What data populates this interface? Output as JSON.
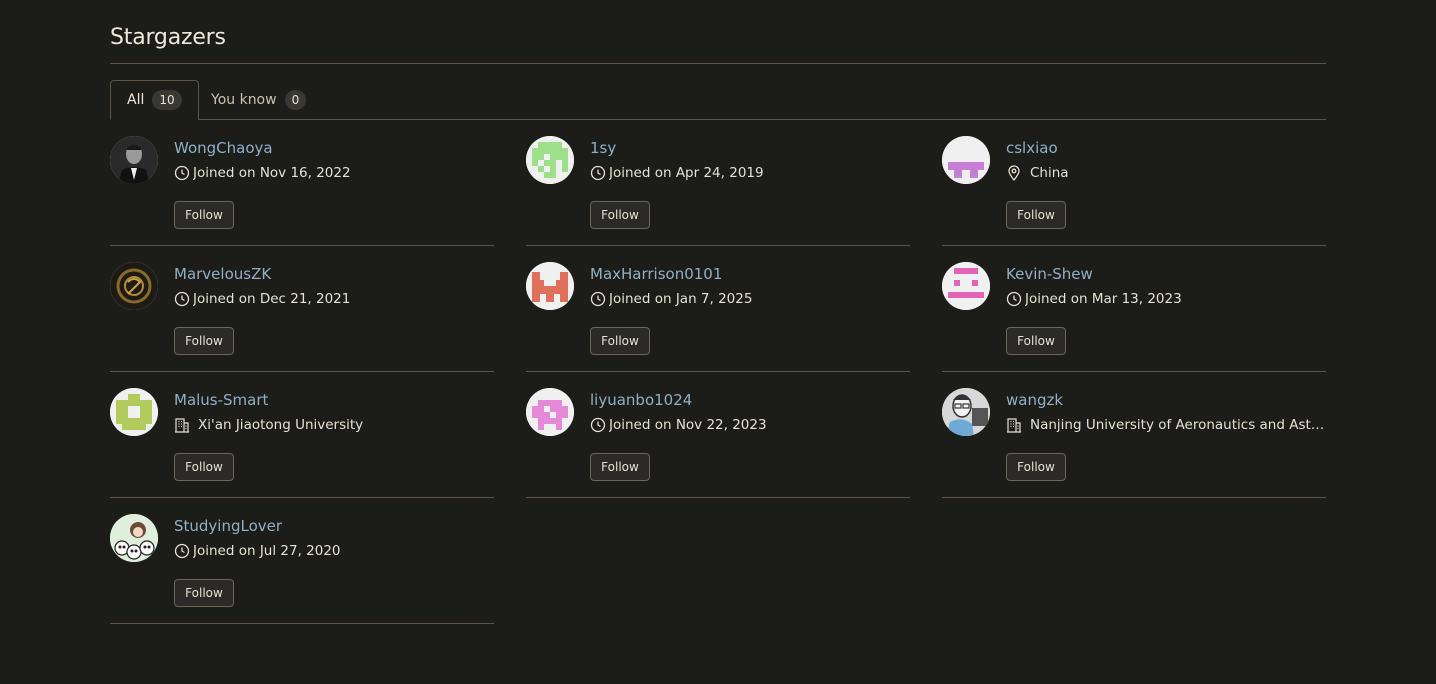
{
  "page": {
    "title": "Stargazers"
  },
  "tabs": [
    {
      "label": "All",
      "count": "10"
    },
    {
      "label": "You know",
      "count": "0"
    }
  ],
  "users": [
    {
      "name": "WongChaoya",
      "meta": "Joined on Nov 16, 2022",
      "meta_icon": "clock-icon",
      "follow": "Follow"
    },
    {
      "name": "1sy",
      "meta": "Joined on Apr 24, 2019",
      "meta_icon": "clock-icon",
      "follow": "Follow"
    },
    {
      "name": "cslxiao",
      "meta": "China",
      "meta_icon": "location-icon",
      "follow": "Follow"
    },
    {
      "name": "MarvelousZK",
      "meta": "Joined on Dec 21, 2021",
      "meta_icon": "clock-icon",
      "follow": "Follow"
    },
    {
      "name": "MaxHarrison0101",
      "meta": "Joined on Jan 7, 2025",
      "meta_icon": "clock-icon",
      "follow": "Follow"
    },
    {
      "name": "Kevin-Shew",
      "meta": "Joined on Mar 13, 2023",
      "meta_icon": "clock-icon",
      "follow": "Follow"
    },
    {
      "name": "Malus-Smart",
      "meta": "Xi'an Jiaotong University",
      "meta_icon": "building-icon",
      "follow": "Follow"
    },
    {
      "name": "liyuanbo1024",
      "meta": "Joined on Nov 22, 2023",
      "meta_icon": "clock-icon",
      "follow": "Follow"
    },
    {
      "name": "wangzk",
      "meta": "Nanjing University of Aeronautics and Astronautics",
      "meta_icon": "building-icon",
      "follow": "Follow"
    },
    {
      "name": "StudyingLover",
      "meta": "Joined on Jul 27, 2020",
      "meta_icon": "clock-icon",
      "follow": "Follow"
    }
  ],
  "colors": {
    "background": "#1c1c19",
    "username": "#8fb0c8",
    "divider": "#5a5548"
  }
}
